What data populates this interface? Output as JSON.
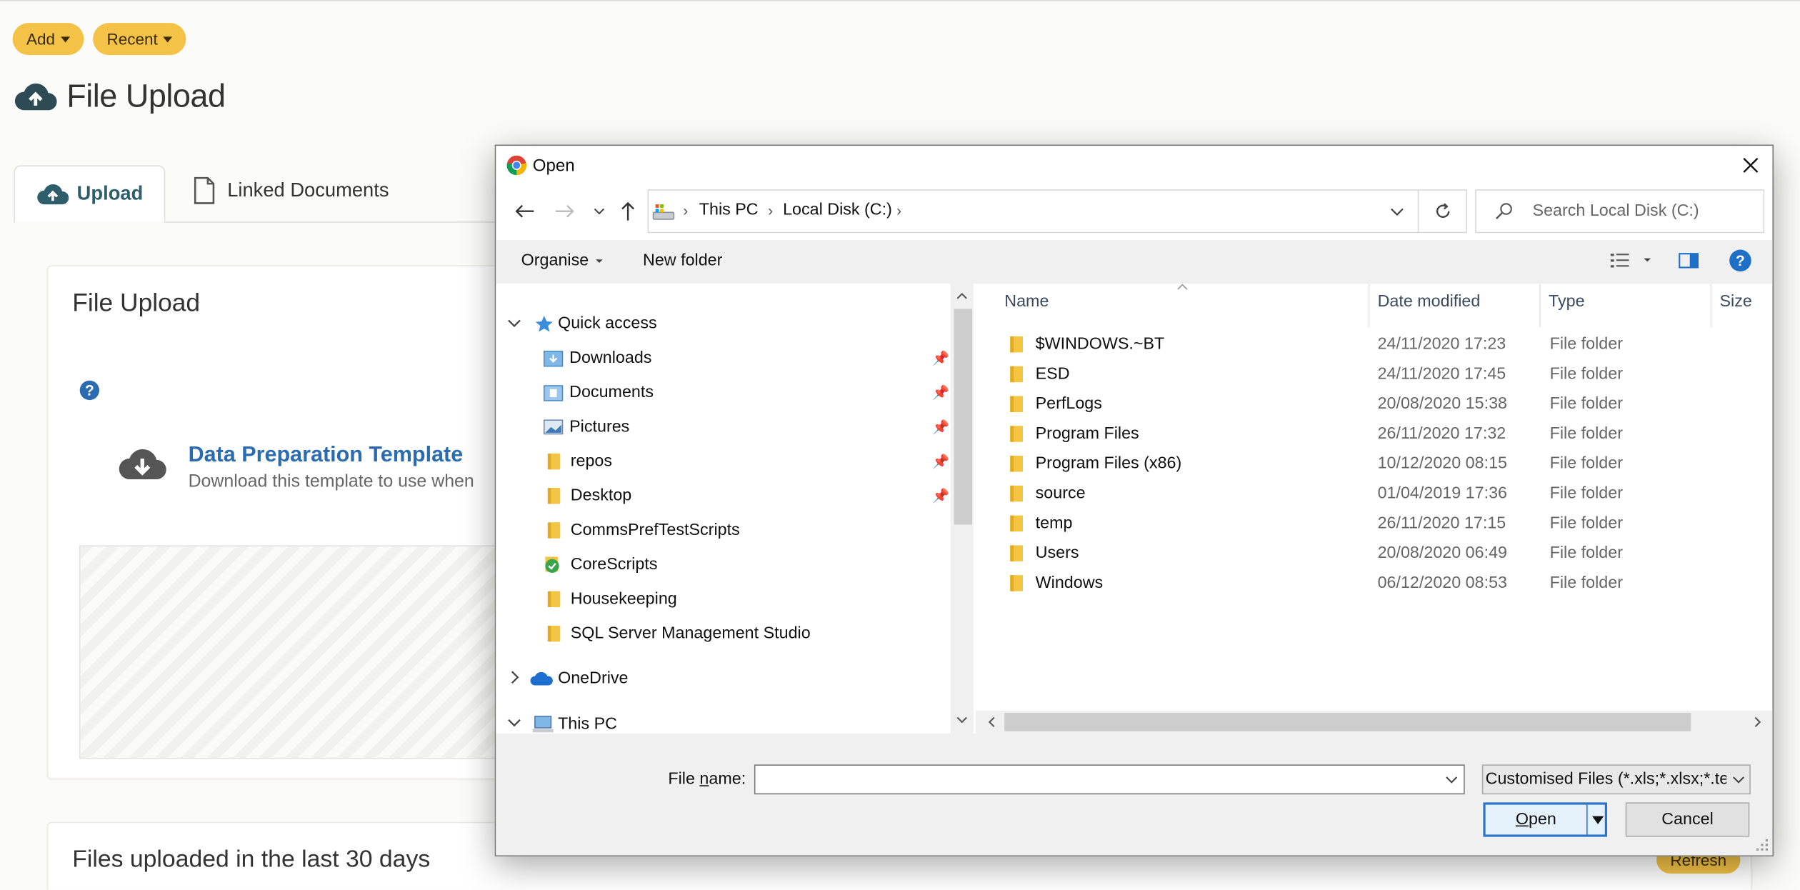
{
  "top_buttons": {
    "add": "Add",
    "recent": "Recent"
  },
  "page": {
    "title": "File Upload"
  },
  "tabs": {
    "upload": "Upload",
    "linked": "Linked Documents"
  },
  "upload_card": {
    "title": "File Upload",
    "template_title": "Data Preparation Template",
    "template_desc": "Download this template to use when"
  },
  "recent_card": {
    "title": "Files uploaded in the last 30 days",
    "refresh": "Refresh"
  },
  "dialog": {
    "title": "Open",
    "breadcrumb": [
      "This PC",
      "Local Disk (C:)"
    ],
    "search_placeholder": "Search Local Disk (C:)",
    "organise": "Organise",
    "new_folder": "New folder",
    "nav_items": [
      {
        "label": "Quick access",
        "level": 0,
        "expanded": true
      },
      {
        "label": "Downloads",
        "pinned": true
      },
      {
        "label": "Documents",
        "pinned": true
      },
      {
        "label": "Pictures",
        "pinned": true
      },
      {
        "label": "repos",
        "pinned": true
      },
      {
        "label": "Desktop",
        "pinned": true
      },
      {
        "label": "CommsPrefTestScripts"
      },
      {
        "label": "CoreScripts"
      },
      {
        "label": "Housekeeping"
      },
      {
        "label": "SQL Server Management Studio"
      },
      {
        "label": "OneDrive",
        "level": 0,
        "expanded": false
      },
      {
        "label": "This PC",
        "level": 0,
        "expanded": true
      }
    ],
    "columns": {
      "name": "Name",
      "date": "Date modified",
      "type": "Type",
      "size": "Size"
    },
    "files": [
      {
        "name": "$WINDOWS.~BT",
        "date": "24/11/2020 17:23",
        "type": "File folder"
      },
      {
        "name": "ESD",
        "date": "24/11/2020 17:45",
        "type": "File folder"
      },
      {
        "name": "PerfLogs",
        "date": "20/08/2020 15:38",
        "type": "File folder"
      },
      {
        "name": "Program Files",
        "date": "26/11/2020 17:32",
        "type": "File folder"
      },
      {
        "name": "Program Files (x86)",
        "date": "10/12/2020 08:15",
        "type": "File folder"
      },
      {
        "name": "source",
        "date": "01/04/2019 17:36",
        "type": "File folder"
      },
      {
        "name": "temp",
        "date": "26/11/2020 17:15",
        "type": "File folder"
      },
      {
        "name": "Users",
        "date": "20/08/2020 06:49",
        "type": "File folder"
      },
      {
        "name": "Windows",
        "date": "06/12/2020 08:53",
        "type": "File folder"
      }
    ],
    "file_name_label_pre": "File ",
    "file_name_label_u": "n",
    "file_name_label_post": "ame:",
    "file_name_value": "",
    "filter": "Customised Files (*.xls;*.xlsx;*.te",
    "open_btn_u": "O",
    "open_btn_rest": "pen",
    "cancel_btn": "Cancel"
  },
  "colors": {
    "accent": "#f3c246",
    "tab_text": "#2e5d6b",
    "link": "#2b6cb0"
  }
}
